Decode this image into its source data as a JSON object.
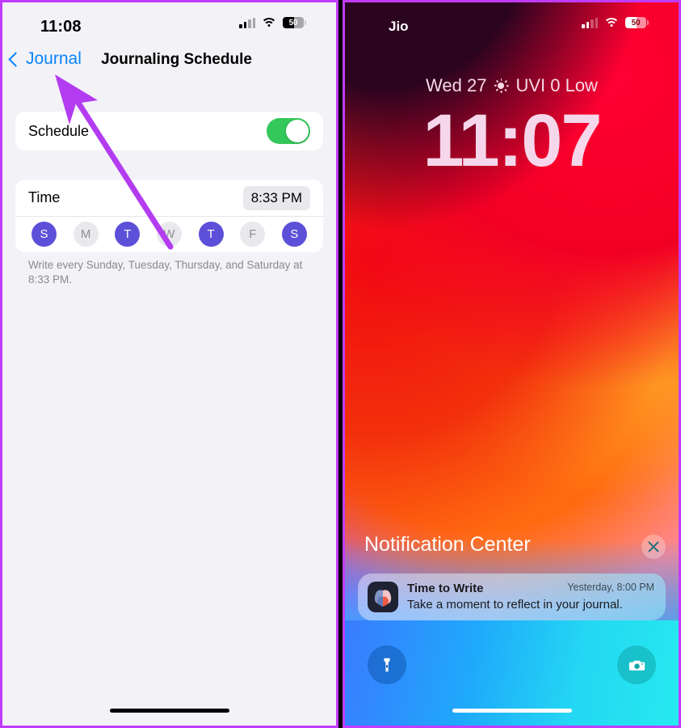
{
  "left_phone": {
    "status_bar": {
      "time": "11:08",
      "signal_icon": "cellular-bars-icon",
      "wifi_icon": "wifi-icon",
      "battery_level": "50"
    },
    "nav": {
      "back_label": "Journal",
      "back_icon": "chevron-left-icon",
      "title": "Journaling Schedule"
    },
    "schedule_row": {
      "label": "Schedule",
      "toggle_state": "on",
      "toggle_color": "#34c759"
    },
    "time_row": {
      "label": "Time",
      "value": "8:33 PM"
    },
    "days": [
      {
        "letter": "S",
        "name": "Sunday",
        "selected": true
      },
      {
        "letter": "M",
        "name": "Monday",
        "selected": false
      },
      {
        "letter": "T",
        "name": "Tuesday",
        "selected": true
      },
      {
        "letter": "W",
        "name": "Wednesday",
        "selected": false
      },
      {
        "letter": "T",
        "name": "Thursday",
        "selected": true
      },
      {
        "letter": "F",
        "name": "Friday",
        "selected": false
      },
      {
        "letter": "S",
        "name": "Saturday",
        "selected": true
      }
    ],
    "selected_day_color": "#5d50d8",
    "footnote": "Write every Sunday, Tuesday, Thursday, and Saturday at 8:33 PM."
  },
  "right_phone": {
    "status_bar": {
      "carrier": "Jio",
      "signal_icon": "cellular-bars-icon",
      "wifi_icon": "wifi-icon",
      "battery_level": "50"
    },
    "lock_screen": {
      "date": "Wed 27",
      "uv_icon": "sun-icon",
      "uv_text": "UVI 0 Low",
      "clock": "11:07"
    },
    "notification_center": {
      "title": "Notification Center",
      "close_icon": "close-icon",
      "notification": {
        "app_icon": "journal-app-icon",
        "title": "Time to Write",
        "body": "Take a moment to reflect in your journal.",
        "timestamp": "Yesterday, 8:00 PM"
      }
    },
    "quick_actions": [
      {
        "icon": "flashlight-icon",
        "name": "flashlight"
      },
      {
        "icon": "camera-icon",
        "name": "camera"
      }
    ]
  },
  "annotation": {
    "arrow_color": "#b43cf0",
    "points_to": "Journal back button"
  }
}
